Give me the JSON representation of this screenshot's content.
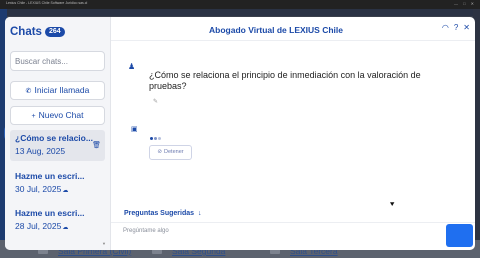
{
  "browser": {
    "tab_title": "Lexius Chile - LEXIUS Chile Software Juridico sas.cl",
    "window_controls": "— □ ✕"
  },
  "background": {
    "salas": [
      "Sala Primera (Civil)",
      "Sala Segunda",
      "Sala Tercera"
    ]
  },
  "sidebar": {
    "title": "Chats",
    "count": "264",
    "search_placeholder": "Buscar chats...",
    "call_button": "Iniciar llamada",
    "new_chat_button": "Nuevo Chat",
    "chats": [
      {
        "title": "¿Cómo se relacio...",
        "date": "13 Aug, 2025",
        "active": true
      },
      {
        "title": "Hazme un escri...",
        "date": "30 Jul, 2025",
        "active": false
      },
      {
        "title": "Hazme un escri...",
        "date": "28 Jul, 2025",
        "active": false
      }
    ]
  },
  "header": {
    "title": "Abogado Virtual de LEXIUS Chile",
    "icons": [
      "loading-icon",
      "help-icon",
      "close-icon"
    ]
  },
  "conversation": {
    "user_message": "¿Cómo se relaciona el principio de inmediación con la valoración de pruebas?",
    "stop_button": "Detener"
  },
  "footer": {
    "suggested_label": "Preguntas Sugeridas",
    "input_placeholder": "Pregúntame algo"
  },
  "colors": {
    "accent": "#1c4aa8",
    "send_button": "#1f6ff0",
    "sidebar_bg": "#f4f5f8"
  }
}
